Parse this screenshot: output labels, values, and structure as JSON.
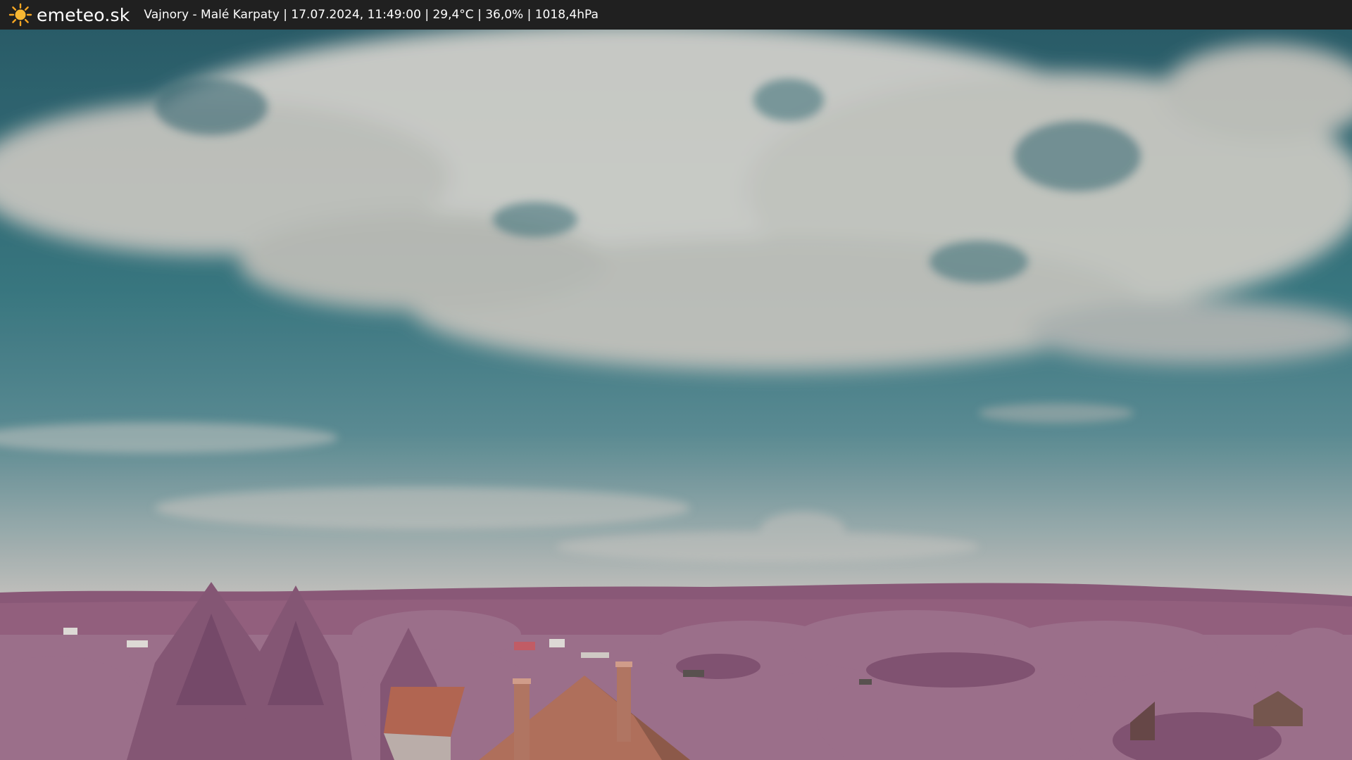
{
  "header": {
    "logo_icon": "sun-icon",
    "brand": "emeteo.sk",
    "caption": "Vajnory - Malé Karpaty | 17.07.2024, 11:49:00 | 29,4°C | 36,0% | 1018,4hPa",
    "background": "#202020"
  },
  "scene": {
    "description_icon": "webcam-photo",
    "sky_top": "#2d6670",
    "sky_horizon": "#c9c4c0",
    "foliage": "#a0728f",
    "field": "#c8b48a",
    "roof": "#b86a55"
  }
}
